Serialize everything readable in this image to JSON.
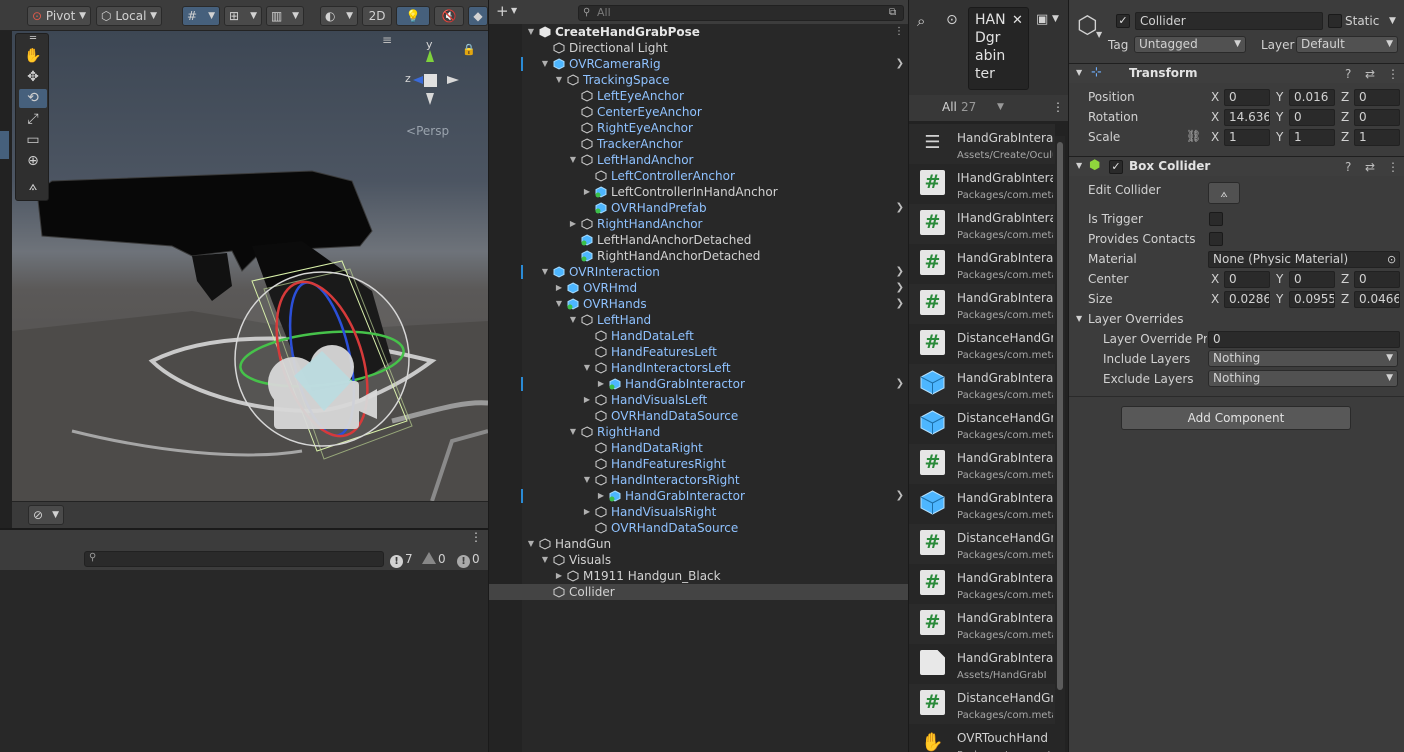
{
  "scene": {
    "toolbar": {
      "pivot_label": "Pivot",
      "local_label": "Local",
      "mode_2d_label": "2D"
    },
    "persp_label": "Persp",
    "gizmo": {
      "y": "y",
      "z": "z"
    }
  },
  "console": {
    "log_count": "7",
    "warn_count": "0",
    "error_count": "0"
  },
  "hierarchy": {
    "search_placeholder": "All",
    "rows": [
      {
        "label": "CreateHandGrabPose",
        "type": "scene",
        "expanded": true
      },
      {
        "label": "Directional Light",
        "type": "plain"
      },
      {
        "label": "OVRCameraRig",
        "type": "prefab"
      },
      {
        "label": "TrackingSpace",
        "type": "prefab"
      },
      {
        "label": "LeftEyeAnchor",
        "type": "prefab"
      },
      {
        "label": "CenterEyeAnchor",
        "type": "prefab"
      },
      {
        "label": "RightEyeAnchor",
        "type": "prefab"
      },
      {
        "label": "TrackerAnchor",
        "type": "prefab"
      },
      {
        "label": "LeftHandAnchor",
        "type": "prefab"
      },
      {
        "label": "LeftControllerAnchor",
        "type": "prefab"
      },
      {
        "label": "LeftControllerInHandAnchor",
        "type": "plain"
      },
      {
        "label": "OVRHandPrefab",
        "type": "prefab"
      },
      {
        "label": "RightHandAnchor",
        "type": "prefab"
      },
      {
        "label": "LeftHandAnchorDetached",
        "type": "plain"
      },
      {
        "label": "RightHandAnchorDetached",
        "type": "plain"
      },
      {
        "label": "OVRInteraction",
        "type": "prefab"
      },
      {
        "label": "OVRHmd",
        "type": "prefab"
      },
      {
        "label": "OVRHands",
        "type": "prefab"
      },
      {
        "label": "LeftHand",
        "type": "prefab"
      },
      {
        "label": "HandDataLeft",
        "type": "prefab"
      },
      {
        "label": "HandFeaturesLeft",
        "type": "prefab"
      },
      {
        "label": "HandInteractorsLeft",
        "type": "prefab"
      },
      {
        "label": "HandGrabInteractor",
        "type": "prefab"
      },
      {
        "label": "HandVisualsLeft",
        "type": "prefab"
      },
      {
        "label": "OVRHandDataSource",
        "type": "prefab"
      },
      {
        "label": "RightHand",
        "type": "prefab"
      },
      {
        "label": "HandDataRight",
        "type": "prefab"
      },
      {
        "label": "HandFeaturesRight",
        "type": "prefab"
      },
      {
        "label": "HandInteractorsRight",
        "type": "prefab"
      },
      {
        "label": "HandGrabInteractor",
        "type": "prefab"
      },
      {
        "label": "HandVisualsRight",
        "type": "prefab"
      },
      {
        "label": "OVRHandDataSource",
        "type": "prefab"
      },
      {
        "label": "HandGun",
        "type": "plain"
      },
      {
        "label": "Visuals",
        "type": "plain"
      },
      {
        "label": "M1911 Handgun_Black",
        "type": "plain"
      },
      {
        "label": "Collider",
        "type": "plain"
      }
    ]
  },
  "project": {
    "search_text": "HANDgrabinter",
    "search_lines": [
      "HAN",
      "Dgr",
      "abin",
      "ter"
    ],
    "all_label": "All",
    "all_count": "27",
    "assets": [
      {
        "name": "HandGrabInteractor",
        "path": "Assets/Create/Oculus",
        "icon": "menu-icon"
      },
      {
        "name": "IHandGrabInteractor",
        "path": "Packages/com.meta",
        "icon": "script-icon"
      },
      {
        "name": "IHandGrabInteractable",
        "path": "Packages/com.meta",
        "icon": "script-icon"
      },
      {
        "name": "HandGrabInteractor",
        "path": "Packages/com.meta",
        "icon": "script-icon"
      },
      {
        "name": "HandGrabInteractable",
        "path": "Packages/com.meta",
        "icon": "script-icon"
      },
      {
        "name": "DistanceHandGrab",
        "path": "Packages/com.meta",
        "icon": "script-icon"
      },
      {
        "name": "HandGrabInteractor",
        "path": "Packages/com.meta",
        "icon": "prefab-icon"
      },
      {
        "name": "DistanceHandGrab",
        "path": "Packages/com.meta",
        "icon": "prefab-icon"
      },
      {
        "name": "HandGrabInteractor",
        "path": "Packages/com.meta",
        "icon": "script-icon"
      },
      {
        "name": "HandGrabInteractor",
        "path": "Packages/com.meta",
        "icon": "prefab-icon"
      },
      {
        "name": "DistanceHandGrab",
        "path": "Packages/com.meta",
        "icon": "script-icon"
      },
      {
        "name": "HandGrabInteractor",
        "path": "Packages/com.meta",
        "icon": "script-icon"
      },
      {
        "name": "HandGrabInteractor",
        "path": "Packages/com.meta",
        "icon": "script-icon"
      },
      {
        "name": "HandGrabInteractor",
        "path": "Assets/HandGrabI",
        "icon": "file-icon"
      },
      {
        "name": "DistanceHandGrab",
        "path": "Packages/com.meta",
        "icon": "script-icon"
      },
      {
        "name": "OVRTouchHand",
        "path": "Packages/com.meta",
        "icon": "hand-icon"
      }
    ]
  },
  "inspector": {
    "object_name": "Collider",
    "static_label": "Static",
    "tag_label": "Tag",
    "tag_value": "Untagged",
    "layer_label": "Layer",
    "layer_value": "Default",
    "transform": {
      "title": "Transform",
      "position_label": "Position",
      "rotation_label": "Rotation",
      "scale_label": "Scale",
      "position": {
        "x": "0",
        "y": "0.016",
        "z": "0"
      },
      "rotation": {
        "x": "14.636",
        "y": "0",
        "z": "0"
      },
      "scale": {
        "x": "1",
        "y": "1",
        "z": "1"
      }
    },
    "box_collider": {
      "title": "Box Collider",
      "edit_collider_label": "Edit Collider",
      "is_trigger_label": "Is Trigger",
      "provides_contacts_label": "Provides Contacts",
      "material_label": "Material",
      "material_value": "None (Physic Material)",
      "center_label": "Center",
      "center": {
        "x": "0",
        "y": "0",
        "z": "0"
      },
      "size_label": "Size",
      "size": {
        "x": "0.0286",
        "y": "0.0955",
        "z": "0.0466"
      },
      "layer_overrides_label": "Layer Overrides",
      "layer_override_priority_label": "Layer Override Pric",
      "layer_override_priority_value": "0",
      "include_layers_label": "Include Layers",
      "include_layers_value": "Nothing",
      "exclude_layers_label": "Exclude Layers",
      "exclude_layers_value": "Nothing"
    },
    "add_component_label": "Add Component"
  },
  "axis_letters": {
    "x": "X",
    "y": "Y",
    "z": "Z"
  },
  "colors": {
    "prefab_text": "#8fc2ff",
    "selection_bar": "#2a8bd6",
    "active_tool": "#46607c"
  }
}
